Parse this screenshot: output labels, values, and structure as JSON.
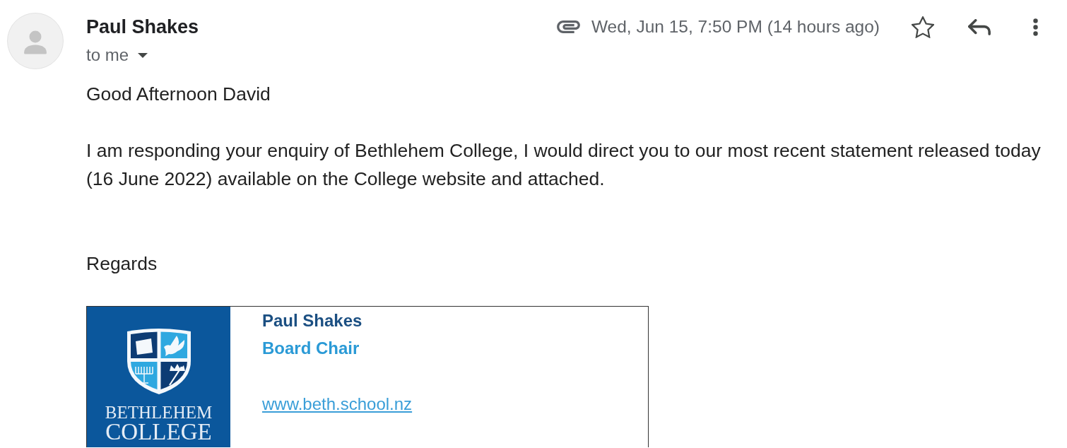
{
  "header": {
    "sender": "Paul Shakes",
    "recipient": "to me",
    "date": "Wed, Jun 15, 7:50 PM (14 hours ago)",
    "starred": false
  },
  "body": {
    "greeting": "Good Afternoon David",
    "message": "I am responding your enquiry of Bethlehem College, I would direct you to our most recent statement released today (16 June 2022) available on the College website and attached.",
    "closing": "Regards"
  },
  "signature": {
    "logo": {
      "top_line": "BETHLEHEM",
      "bottom_line": "COLLEGE"
    },
    "name": "Paul Shakes",
    "title": "Board Chair",
    "website": "www.beth.school.nz"
  }
}
